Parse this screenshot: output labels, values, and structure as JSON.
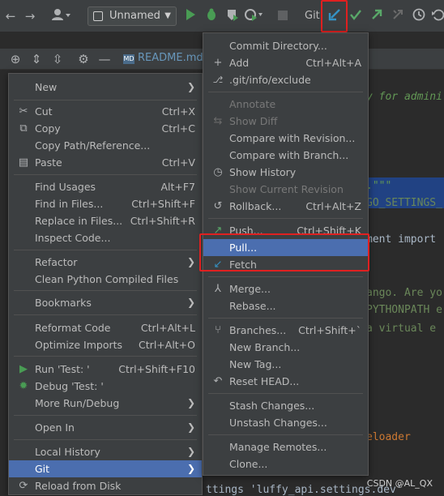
{
  "toolbar": {
    "run_config": "Unnamed",
    "git_label": "Git:",
    "colors": {
      "run": "#499c54",
      "debug": "#499c54",
      "update": "#3592c4",
      "commit": "#59a869",
      "push": "#59a869"
    }
  },
  "tabs": {
    "readme": "README.md"
  },
  "editor_lines": [
    "y for admini",
    ".\"\"\"",
    "GO_SETTINGS_",
    "ment import",
    "ango. Are yo",
    "PYTHONPATH e",
    " a virtual e",
    "eloader",
    "ttings 'luffy_api.settings.dev'"
  ],
  "left_menu": {
    "items": [
      {
        "label": "New",
        "shortcut": "",
        "submenu": true,
        "icon": ""
      },
      {
        "label": "Cut",
        "shortcut": "Ctrl+X",
        "submenu": false,
        "icon": "scissors-icon"
      },
      {
        "label": "Copy",
        "shortcut": "Ctrl+C",
        "submenu": false,
        "icon": "copy-icon"
      },
      {
        "label": "Copy Path/Reference...",
        "shortcut": "",
        "submenu": false,
        "icon": ""
      },
      {
        "label": "Paste",
        "shortcut": "Ctrl+V",
        "submenu": false,
        "icon": "paste-icon"
      },
      {
        "label": "Find Usages",
        "shortcut": "Alt+F7",
        "submenu": false,
        "icon": ""
      },
      {
        "label": "Find in Files...",
        "shortcut": "Ctrl+Shift+F",
        "submenu": false,
        "icon": ""
      },
      {
        "label": "Replace in Files...",
        "shortcut": "Ctrl+Shift+R",
        "submenu": false,
        "icon": ""
      },
      {
        "label": "Inspect Code...",
        "shortcut": "",
        "submenu": false,
        "icon": ""
      },
      {
        "label": "Refactor",
        "shortcut": "",
        "submenu": true,
        "icon": ""
      },
      {
        "label": "Clean Python Compiled Files",
        "shortcut": "",
        "submenu": false,
        "icon": ""
      },
      {
        "label": "Bookmarks",
        "shortcut": "",
        "submenu": true,
        "icon": ""
      },
      {
        "label": "Reformat Code",
        "shortcut": "Ctrl+Alt+L",
        "submenu": false,
        "icon": ""
      },
      {
        "label": "Optimize Imports",
        "shortcut": "Ctrl+Alt+O",
        "submenu": false,
        "icon": ""
      },
      {
        "label": "Run 'Test: '",
        "shortcut": "Ctrl+Shift+F10",
        "submenu": false,
        "icon": "run-icon"
      },
      {
        "label": "Debug 'Test: '",
        "shortcut": "",
        "submenu": false,
        "icon": "debug-icon"
      },
      {
        "label": "More Run/Debug",
        "shortcut": "",
        "submenu": true,
        "icon": ""
      },
      {
        "label": "Open In",
        "shortcut": "",
        "submenu": true,
        "icon": ""
      },
      {
        "label": "Local History",
        "shortcut": "",
        "submenu": true,
        "icon": ""
      },
      {
        "label": "Git",
        "shortcut": "",
        "submenu": true,
        "icon": ""
      },
      {
        "label": "Reload from Disk",
        "shortcut": "",
        "submenu": false,
        "icon": "reload-icon"
      }
    ]
  },
  "right_menu": {
    "items": [
      {
        "label": "Commit Directory...",
        "shortcut": "",
        "icon": ""
      },
      {
        "label": "Add",
        "shortcut": "Ctrl+Alt+A",
        "icon": "plus-icon"
      },
      {
        "label": ".git/info/exclude",
        "shortcut": "",
        "icon": "git-icon"
      },
      {
        "label": "Annotate",
        "shortcut": "",
        "icon": ""
      },
      {
        "label": "Show Diff",
        "shortcut": "",
        "icon": "diff-icon"
      },
      {
        "label": "Compare with Revision...",
        "shortcut": "",
        "icon": ""
      },
      {
        "label": "Compare with Branch...",
        "shortcut": "",
        "icon": ""
      },
      {
        "label": "Show History",
        "shortcut": "",
        "icon": "clock-icon"
      },
      {
        "label": "Show Current Revision",
        "shortcut": "",
        "icon": ""
      },
      {
        "label": "Rollback...",
        "shortcut": "Ctrl+Alt+Z",
        "icon": "rollback-icon"
      },
      {
        "label": "Push...",
        "shortcut": "Ctrl+Shift+K",
        "icon": "push-icon"
      },
      {
        "label": "Pull...",
        "shortcut": "",
        "icon": ""
      },
      {
        "label": "Fetch",
        "shortcut": "",
        "icon": "fetch-icon"
      },
      {
        "label": "Merge...",
        "shortcut": "",
        "icon": "merge-icon"
      },
      {
        "label": "Rebase...",
        "shortcut": "",
        "icon": ""
      },
      {
        "label": "Branches...",
        "shortcut": "Ctrl+Shift+`",
        "icon": "branch-icon"
      },
      {
        "label": "New Branch...",
        "shortcut": "",
        "icon": ""
      },
      {
        "label": "New Tag...",
        "shortcut": "",
        "icon": ""
      },
      {
        "label": "Reset HEAD...",
        "shortcut": "",
        "icon": "reset-icon"
      },
      {
        "label": "Stash Changes...",
        "shortcut": "",
        "icon": ""
      },
      {
        "label": "Unstash Changes...",
        "shortcut": "",
        "icon": ""
      },
      {
        "label": "Manage Remotes...",
        "shortcut": "",
        "icon": ""
      },
      {
        "label": "Clone...",
        "shortcut": "",
        "icon": ""
      }
    ]
  },
  "watermark": "CSDN @AL_QX"
}
